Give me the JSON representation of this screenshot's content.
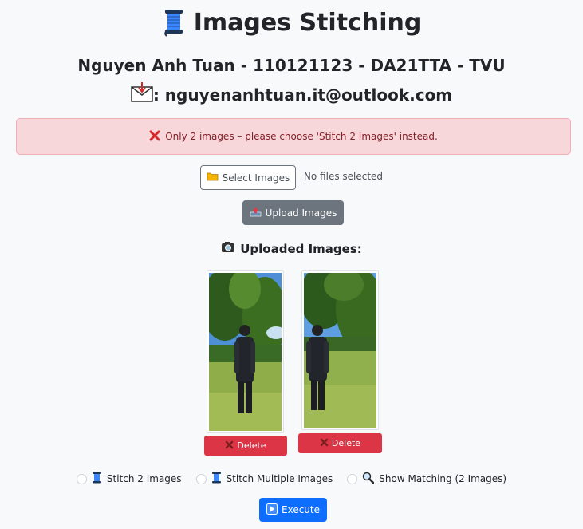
{
  "header": {
    "title": "Images Stitching",
    "author": "Nguyen Anh Tuan - 110121123 - DA21TTA - TVU",
    "email": ": nguyenanhtuan.it@outlook.com"
  },
  "alert": {
    "message": "Only 2 images – please choose 'Stitch 2 Images' instead.",
    "color": "#f8d7da"
  },
  "upload": {
    "select_label": "Select Images",
    "file_status": "No files selected",
    "upload_label": "Upload Images"
  },
  "uploaded": {
    "heading": "Uploaded Images:",
    "images": [
      {
        "delete_label": "Delete"
      },
      {
        "delete_label": "Delete"
      }
    ]
  },
  "modes": {
    "options": [
      {
        "label": "Stitch 2 Images",
        "selected": false
      },
      {
        "label": "Stitch Multiple Images",
        "selected": false
      },
      {
        "label": "Show Matching (2 Images)",
        "selected": false
      }
    ]
  },
  "actions": {
    "execute_label": "Execute"
  },
  "colors": {
    "danger": "#dc3545",
    "primary": "#0d6efd",
    "secondary": "#6c757d"
  }
}
